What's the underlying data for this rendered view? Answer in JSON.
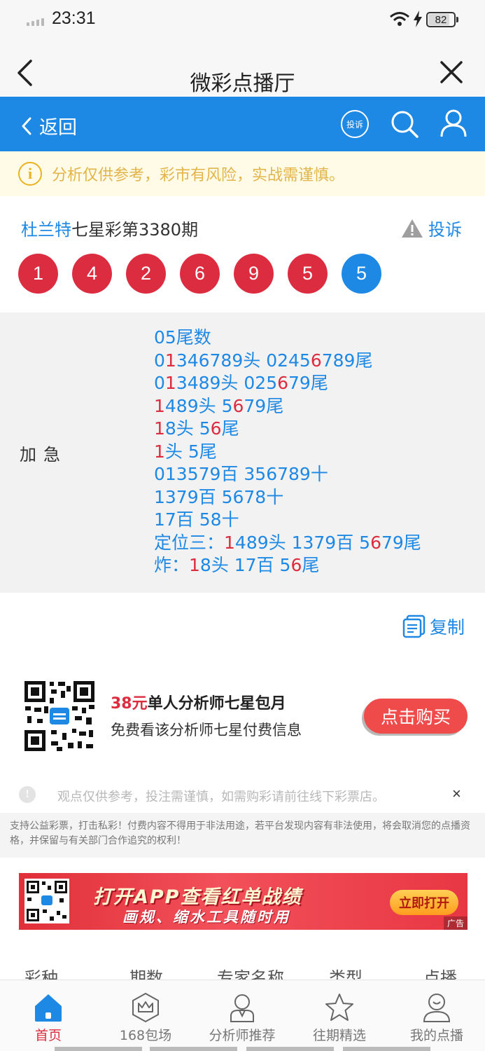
{
  "status_bar": {
    "time": "23:31",
    "battery": "82",
    "battery_level": 0.82
  },
  "title_bar": {
    "title": "微彩点播厅"
  },
  "nav": {
    "back_label": "返回",
    "complain_label": "投诉"
  },
  "warning": {
    "text": "分析仅供参考，彩市有风险，实战需谨慎。"
  },
  "lottery": {
    "name": "杜兰特",
    "issue_text": "七星彩第3380期",
    "complain_label": "投诉",
    "balls": [
      "1",
      "4",
      "2",
      "6",
      "9",
      "5",
      "5"
    ],
    "ball_colors": {
      "red": "#dc2d40",
      "blue": "#1e88e5"
    }
  },
  "prediction": {
    "label": "加急",
    "lines": [
      [
        {
          "t": "05尾数",
          "h": false
        }
      ],
      [
        {
          "t": "0",
          "h": false
        },
        {
          "t": "1",
          "h": true
        },
        {
          "t": "346789头 0245",
          "h": false
        },
        {
          "t": "6",
          "h": true
        },
        {
          "t": "789尾",
          "h": false
        }
      ],
      [
        {
          "t": "0",
          "h": false
        },
        {
          "t": "1",
          "h": true
        },
        {
          "t": "3489头 025",
          "h": false
        },
        {
          "t": "6",
          "h": true
        },
        {
          "t": "79尾",
          "h": false
        }
      ],
      [
        {
          "t": "1",
          "h": true
        },
        {
          "t": "489头 5",
          "h": false
        },
        {
          "t": "6",
          "h": true
        },
        {
          "t": "79尾",
          "h": false
        }
      ],
      [
        {
          "t": "1",
          "h": true
        },
        {
          "t": "8头 5",
          "h": false
        },
        {
          "t": "6",
          "h": true
        },
        {
          "t": "尾",
          "h": false
        }
      ],
      [
        {
          "t": "1",
          "h": true
        },
        {
          "t": "头 5尾",
          "h": false
        }
      ],
      [
        {
          "t": "013579百 356789十",
          "h": false
        }
      ],
      [
        {
          "t": "1379百 5678十",
          "h": false
        }
      ],
      [
        {
          "t": "17百 58十",
          "h": false
        }
      ],
      [
        {
          "t": "定位三：",
          "h": false
        },
        {
          "t": "1",
          "h": true
        },
        {
          "t": "489头 1379百 5",
          "h": false
        },
        {
          "t": "6",
          "h": true
        },
        {
          "t": "79尾",
          "h": false
        }
      ],
      [
        {
          "t": "炸：",
          "h": false
        },
        {
          "t": "1",
          "h": true
        },
        {
          "t": "8头 17百 5",
          "h": false
        },
        {
          "t": "6",
          "h": true
        },
        {
          "t": "尾",
          "h": false
        }
      ]
    ]
  },
  "copy": {
    "label": "复制"
  },
  "package": {
    "price": "38元",
    "title": "单人分析师七星包月",
    "desc": "免费看该分析师七星付费信息",
    "buy_label": "点击购买"
  },
  "notice": {
    "text": "观点仅供参考，投注需谨慎，如需购彩请前往线下彩票店。",
    "close": "×"
  },
  "legal": {
    "text": "支持公益彩票，打击私彩！付费内容不得用于非法用途，若平台发现内容有非法使用，将会取消您的点播资格，并保留与有关部门合作追究的权利！"
  },
  "ad": {
    "line1": "打开APP查看红单战绩",
    "line2": "画规、缩水工具随时用",
    "button": "立即打开",
    "tag": "广告"
  },
  "table_headers": [
    "彩种",
    "期数",
    "专家名称",
    "类型",
    "点播"
  ],
  "tabs": [
    {
      "label": "首页",
      "icon": "home-icon",
      "active": true
    },
    {
      "label": "168包场",
      "icon": "crown-icon",
      "active": false
    },
    {
      "label": "分析师推荐",
      "icon": "analyst-icon",
      "active": false
    },
    {
      "label": "往期精选",
      "icon": "star-icon",
      "active": false
    },
    {
      "label": "我的点播",
      "icon": "profile-icon",
      "active": false
    }
  ]
}
